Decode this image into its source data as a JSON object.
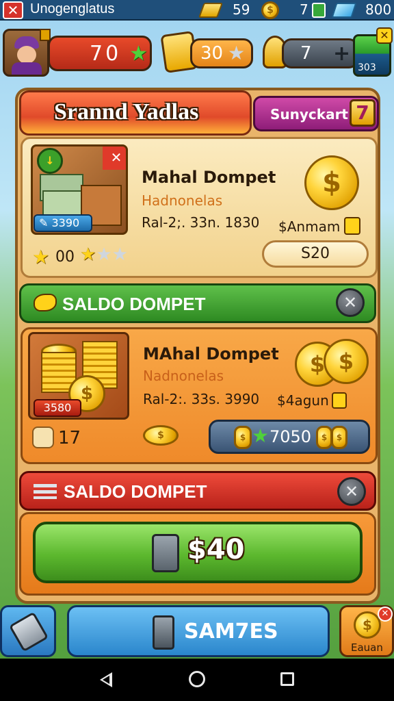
{
  "status_bar": {
    "title": "Unogenglatus",
    "val1": "59",
    "val2": "7",
    "val3": "800"
  },
  "hud": {
    "player_value": "70",
    "ticket_value": "30",
    "key_value": "7",
    "chest_value": "303"
  },
  "header": {
    "title": "Srannd Yadlas",
    "side_tab": "Sunyckart",
    "side_tab_badge": "7"
  },
  "offer1": {
    "name": "Mahal Dompet",
    "subtitle": "Hadnonelas",
    "details": "Ral-2;. 33n. 1830",
    "price_label": "$Anmam",
    "badge": "3390",
    "stars_text": "00",
    "button": "S20"
  },
  "section1": {
    "label": "SALDO DOMPET"
  },
  "offer2": {
    "name": "MAhal Dompet",
    "subtitle": "Nadnonelas",
    "details": "Ral-2:. 33s. 3990",
    "price_label": "$4agun",
    "badge": "3580",
    "count": "17",
    "amount": "7050"
  },
  "section2": {
    "label": "SALDO DOMPET"
  },
  "buy_button": {
    "label": "$40"
  },
  "bottom_bar": {
    "main_label": "SAM7ES",
    "right_label": "Eauan"
  },
  "colors": {
    "green_banner": "#3f9b2d",
    "red_banner": "#d83a2a",
    "panel_cream": "#f7e3b0",
    "panel_orange": "#f39a3a",
    "buy_green": "#6cc83a",
    "blue_button": "#3aa0e0"
  }
}
